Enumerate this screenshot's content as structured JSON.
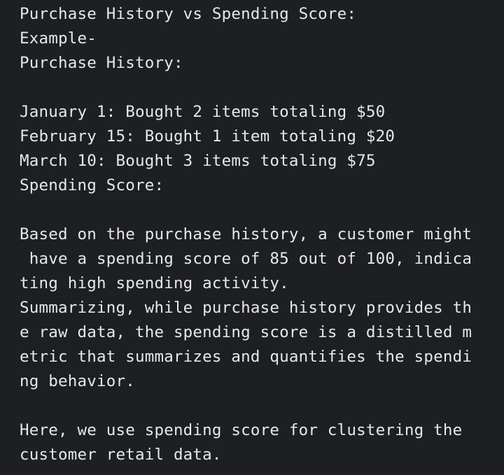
{
  "document": {
    "lines": [
      "Purchase History vs Spending Score:",
      "Example-",
      "Purchase History:",
      "",
      "January 1: Bought 2 items totaling $50",
      "February 15: Bought 1 item totaling $20",
      "March 10: Bought 3 items totaling $75",
      "Spending Score:",
      "",
      "Based on the purchase history, a customer might",
      " have a spending score of 85 out of 100, indica",
      "ting high spending activity.",
      "Summarizing, while purchase history provides th",
      "e raw data, the spending score is a distilled m",
      "etric that summarizes and quantifies the spendi",
      "ng behavior.",
      "",
      "Here, we use spending score for clustering the",
      "customer retail data."
    ]
  }
}
